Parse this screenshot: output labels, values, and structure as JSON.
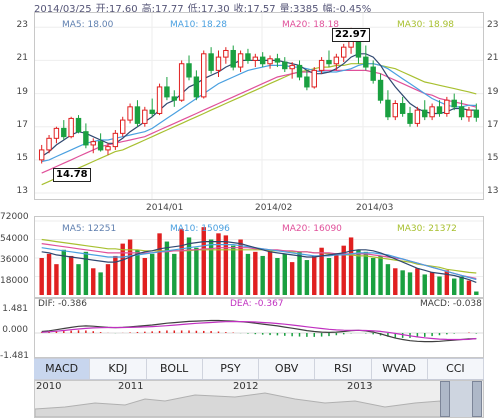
{
  "header": {
    "date": "2014/03/25",
    "open": "开:17.60",
    "high": "高:17.77",
    "low": "低:17.30",
    "close": "收:17.57",
    "volume": "量:3385",
    "change": "幅:-0.45%"
  },
  "price_panel": {
    "legend": [
      {
        "label": "MA5: 18.00",
        "color": "#6080b0"
      },
      {
        "label": "MA10: 18.28",
        "color": "#4aa0e0"
      },
      {
        "label": "MA20: 18.18",
        "color": "#e0509a"
      },
      {
        "label": "MA30: 18.98",
        "color": "#a8c030"
      }
    ],
    "y_ticks": [
      "23",
      "21",
      "19",
      "17",
      "15",
      "13"
    ],
    "x_ticks": [
      "2014/01",
      "2014/02",
      "2014/03"
    ],
    "max_label": "22.97",
    "min_label": "14.78",
    "up_color": "#e02020",
    "down_color": "#1aa040"
  },
  "volume_panel": {
    "legend": [
      {
        "label": "MA5: 12251",
        "color": "#6080b0"
      },
      {
        "label": "MA10: 15096",
        "color": "#4aa0e0"
      },
      {
        "label": "MA20: 16090",
        "color": "#e0509a"
      },
      {
        "label": "MA30: 21372",
        "color": "#a8c030"
      }
    ],
    "y_ticks": [
      "72000",
      "54000",
      "36000",
      "18000"
    ]
  },
  "macd_panel": {
    "legend": [
      {
        "label": "DIF: -0.386",
        "color": "#404040"
      },
      {
        "label": "DEA: -0.367",
        "color": "#c030c0"
      },
      {
        "label": "MACD: -0.038",
        "color": "#404040"
      }
    ],
    "y_ticks": [
      "1.481",
      "0.000",
      "-1.481"
    ]
  },
  "indicator_tabs": [
    "MACD",
    "KDJ",
    "BOLL",
    "PSY",
    "OBV",
    "RSI",
    "WVAD",
    "CCI"
  ],
  "active_tab": "MACD",
  "navigator": {
    "years": [
      "2010",
      "2011",
      "2012",
      "2013"
    ]
  },
  "chart_data": {
    "type": "candlestick",
    "title": "",
    "ylim": [
      13,
      23.5
    ],
    "up_color": "#e02020",
    "down_color": "#1aa040",
    "candles": [
      [
        15.0,
        15.9,
        14.78,
        15.6
      ],
      [
        15.6,
        16.5,
        15.4,
        16.3
      ],
      [
        16.3,
        17.0,
        16.0,
        16.9
      ],
      [
        16.9,
        17.4,
        16.2,
        16.4
      ],
      [
        16.4,
        17.6,
        16.3,
        17.5
      ],
      [
        17.5,
        17.7,
        16.6,
        16.7
      ],
      [
        16.7,
        17.2,
        15.7,
        15.9
      ],
      [
        15.9,
        16.3,
        15.4,
        16.1
      ],
      [
        16.1,
        16.6,
        15.5,
        15.6
      ],
      [
        15.6,
        16.0,
        15.3,
        15.8
      ],
      [
        15.8,
        16.8,
        15.6,
        16.6
      ],
      [
        16.6,
        17.6,
        16.4,
        17.4
      ],
      [
        17.4,
        18.4,
        17.2,
        18.2
      ],
      [
        18.2,
        18.6,
        17.0,
        17.2
      ],
      [
        17.2,
        18.2,
        17.0,
        18.0
      ],
      [
        18.0,
        18.7,
        17.6,
        17.8
      ],
      [
        17.8,
        19.6,
        17.7,
        19.4
      ],
      [
        19.4,
        20.0,
        18.6,
        18.8
      ],
      [
        18.8,
        19.2,
        18.2,
        18.6
      ],
      [
        18.6,
        21.0,
        18.5,
        20.8
      ],
      [
        20.8,
        21.3,
        19.8,
        20.0
      ],
      [
        20.0,
        20.4,
        18.6,
        18.8
      ],
      [
        18.8,
        21.6,
        18.7,
        21.4
      ],
      [
        21.4,
        21.8,
        20.2,
        20.4
      ],
      [
        20.4,
        21.6,
        20.0,
        21.2
      ],
      [
        21.2,
        21.8,
        20.8,
        21.6
      ],
      [
        21.6,
        21.9,
        20.4,
        20.6
      ],
      [
        20.6,
        21.6,
        20.3,
        21.4
      ],
      [
        21.4,
        21.7,
        20.8,
        21.0
      ],
      [
        21.0,
        21.4,
        20.6,
        21.2
      ],
      [
        21.2,
        21.5,
        20.6,
        20.8
      ],
      [
        20.8,
        21.3,
        20.5,
        21.1
      ],
      [
        21.1,
        21.4,
        20.6,
        20.9
      ],
      [
        20.9,
        21.2,
        20.3,
        20.5
      ],
      [
        20.5,
        20.9,
        19.9,
        20.7
      ],
      [
        20.7,
        21.0,
        19.8,
        20.0
      ],
      [
        20.0,
        20.4,
        19.2,
        19.4
      ],
      [
        19.4,
        20.6,
        19.3,
        20.4
      ],
      [
        20.4,
        21.2,
        20.2,
        21.0
      ],
      [
        21.0,
        21.6,
        20.6,
        20.8
      ],
      [
        20.8,
        21.4,
        20.4,
        21.2
      ],
      [
        21.2,
        22.0,
        20.9,
        21.8
      ],
      [
        21.8,
        22.97,
        21.4,
        22.4
      ],
      [
        22.4,
        22.6,
        20.8,
        21.2
      ],
      [
        21.2,
        21.9,
        20.4,
        20.6
      ],
      [
        20.6,
        21.0,
        19.6,
        19.8
      ],
      [
        19.8,
        20.2,
        18.4,
        18.6
      ],
      [
        18.6,
        19.2,
        17.4,
        17.6
      ],
      [
        17.6,
        18.6,
        17.4,
        18.4
      ],
      [
        18.4,
        18.8,
        17.6,
        17.8
      ],
      [
        17.8,
        18.2,
        17.0,
        17.2
      ],
      [
        17.2,
        18.2,
        17.0,
        18.0
      ],
      [
        18.0,
        18.6,
        17.4,
        17.6
      ],
      [
        17.6,
        18.4,
        17.4,
        18.2
      ],
      [
        18.2,
        18.6,
        17.6,
        17.8
      ],
      [
        17.8,
        18.8,
        17.6,
        18.6
      ],
      [
        18.6,
        19.0,
        18.0,
        18.2
      ],
      [
        18.2,
        18.6,
        17.4,
        17.6
      ],
      [
        17.6,
        18.2,
        17.3,
        18.0
      ],
      [
        18.0,
        18.4,
        17.3,
        17.57
      ]
    ],
    "ma5": [
      15.2,
      15.5,
      15.9,
      16.2,
      16.5,
      16.7,
      16.6,
      16.4,
      16.2,
      16.0,
      16.0,
      16.3,
      16.7,
      17.0,
      17.3,
      17.6,
      18.0,
      18.4,
      18.6,
      19.0,
      19.4,
      19.6,
      19.9,
      20.1,
      20.3,
      20.6,
      20.8,
      21.0,
      21.0,
      21.0,
      21.0,
      21.0,
      21.0,
      20.9,
      20.8,
      20.7,
      20.4,
      20.2,
      20.2,
      20.3,
      20.5,
      20.8,
      21.2,
      21.4,
      21.4,
      21.2,
      20.7,
      20.0,
      19.4,
      18.9,
      18.4,
      18.1,
      17.9,
      17.8,
      17.8,
      17.9,
      18.1,
      18.1,
      18.0,
      18.0
    ],
    "ma10": [
      14.9,
      15.0,
      15.2,
      15.4,
      15.6,
      15.8,
      16.0,
      16.1,
      16.2,
      16.2,
      16.3,
      16.4,
      16.5,
      16.6,
      16.7,
      16.9,
      17.2,
      17.5,
      17.8,
      18.1,
      18.4,
      18.7,
      19.0,
      19.3,
      19.6,
      19.8,
      20.0,
      20.2,
      20.4,
      20.5,
      20.6,
      20.7,
      20.7,
      20.7,
      20.6,
      20.6,
      20.5,
      20.4,
      20.3,
      20.3,
      20.3,
      20.4,
      20.5,
      20.7,
      20.8,
      20.8,
      20.7,
      20.5,
      20.2,
      19.9,
      19.6,
      19.3,
      19.0,
      18.7,
      18.5,
      18.3,
      18.2,
      18.2,
      18.3,
      18.28
    ],
    "ma20": [
      14.2,
      14.4,
      14.6,
      14.8,
      15.0,
      15.2,
      15.4,
      15.6,
      15.8,
      15.9,
      16.0,
      16.1,
      16.2,
      16.3,
      16.4,
      16.6,
      16.8,
      17.0,
      17.2,
      17.4,
      17.6,
      17.8,
      18.0,
      18.2,
      18.4,
      18.6,
      18.8,
      19.0,
      19.2,
      19.4,
      19.6,
      19.8,
      20.0,
      20.1,
      20.2,
      20.3,
      20.3,
      20.3,
      20.4,
      20.4,
      20.4,
      20.4,
      20.4,
      20.4,
      20.4,
      20.3,
      20.2,
      20.0,
      19.8,
      19.6,
      19.4,
      19.2,
      19.0,
      18.9,
      18.7,
      18.6,
      18.5,
      18.4,
      18.3,
      18.18
    ],
    "ma30": [
      13.5,
      13.7,
      13.9,
      14.1,
      14.3,
      14.5,
      14.7,
      14.9,
      15.1,
      15.3,
      15.5,
      15.6,
      15.8,
      16.0,
      16.2,
      16.4,
      16.6,
      16.8,
      17.0,
      17.2,
      17.4,
      17.6,
      17.8,
      18.0,
      18.2,
      18.4,
      18.6,
      18.8,
      19.0,
      19.2,
      19.4,
      19.6,
      19.8,
      20.0,
      20.2,
      20.3,
      20.4,
      20.5,
      20.6,
      20.6,
      20.7,
      20.7,
      20.8,
      20.8,
      20.8,
      20.8,
      20.7,
      20.6,
      20.5,
      20.3,
      20.1,
      19.9,
      19.7,
      19.6,
      19.5,
      19.4,
      19.3,
      19.2,
      19.1,
      18.98
    ],
    "volume": {
      "ylim": [
        0,
        72000
      ],
      "values": [
        36000,
        40000,
        30000,
        44000,
        38000,
        30000,
        42000,
        26000,
        22000,
        30000,
        38000,
        50000,
        54000,
        44000,
        36000,
        40000,
        60000,
        52000,
        40000,
        64000,
        56000,
        46000,
        66000,
        54000,
        60000,
        58000,
        48000,
        54000,
        40000,
        42000,
        38000,
        44000,
        36000,
        40000,
        32000,
        42000,
        34000,
        38000,
        46000,
        36000,
        40000,
        48000,
        56000,
        44000,
        42000,
        36000,
        38000,
        30000,
        26000,
        24000,
        22000,
        26000,
        20000,
        22000,
        18000,
        24000,
        16000,
        18000,
        14000,
        3385
      ],
      "ma5": [
        42000,
        41000,
        39000,
        38000,
        37000,
        36000,
        35000,
        34000,
        33000,
        32000,
        32000,
        34000,
        37000,
        40000,
        42000,
        43000,
        45000,
        46000,
        47000,
        48000,
        50000,
        51000,
        52000,
        52000,
        52000,
        52000,
        51000,
        50000,
        48000,
        46000,
        44000,
        42000,
        41000,
        40000,
        39000,
        38000,
        37000,
        37000,
        38000,
        39000,
        40000,
        41000,
        43000,
        44000,
        44000,
        43000,
        41000,
        38000,
        35000,
        32000,
        29000,
        26000,
        24000,
        22000,
        21000,
        20000,
        19000,
        17000,
        15000,
        12251
      ],
      "ma10": [
        46000,
        45000,
        44000,
        43000,
        42000,
        41000,
        40000,
        39000,
        38000,
        37000,
        37000,
        37000,
        38000,
        39000,
        40000,
        41000,
        42000,
        43000,
        44000,
        45000,
        46000,
        47000,
        48000,
        49000,
        49000,
        49000,
        49000,
        48000,
        47000,
        46000,
        45000,
        44000,
        43000,
        42000,
        41000,
        40000,
        39000,
        38000,
        38000,
        38000,
        39000,
        39000,
        40000,
        41000,
        41000,
        41000,
        40000,
        39000,
        37000,
        35000,
        33000,
        31000,
        29000,
        27000,
        25000,
        23000,
        21000,
        19000,
        17000,
        15096
      ],
      "ma20": [
        50000,
        49000,
        48000,
        47000,
        46000,
        45000,
        44000,
        43000,
        42000,
        41000,
        41000,
        41000,
        41000,
        41000,
        41000,
        41000,
        42000,
        42000,
        43000,
        43000,
        44000,
        44000,
        45000,
        45000,
        46000,
        46000,
        46000,
        46000,
        46000,
        45000,
        45000,
        44000,
        44000,
        43000,
        43000,
        42000,
        42000,
        41000,
        41000,
        41000,
        40000,
        40000,
        40000,
        40000,
        40000,
        39000,
        38000,
        37000,
        36000,
        35000,
        33000,
        31000,
        29000,
        27000,
        25000,
        23000,
        21000,
        19000,
        17500,
        16090
      ],
      "ma30": [
        54000,
        53000,
        52000,
        51000,
        50000,
        49000,
        48000,
        47000,
        46000,
        45000,
        45000,
        44000,
        44000,
        44000,
        43000,
        43000,
        43000,
        43000,
        43000,
        43000,
        43000,
        44000,
        44000,
        44000,
        44000,
        44000,
        44000,
        44000,
        44000,
        44000,
        44000,
        43000,
        43000,
        43000,
        42000,
        42000,
        42000,
        41000,
        41000,
        40000,
        40000,
        39000,
        39000,
        38000,
        38000,
        37000,
        36000,
        35000,
        34000,
        33000,
        32000,
        30000,
        29000,
        28000,
        27000,
        25000,
        24000,
        23000,
        22000,
        21372
      ]
    },
    "macd": {
      "ylim": [
        -1.481,
        1.481
      ],
      "dif": [
        0.1,
        0.15,
        0.22,
        0.3,
        0.38,
        0.45,
        0.48,
        0.46,
        0.42,
        0.38,
        0.36,
        0.38,
        0.42,
        0.46,
        0.5,
        0.54,
        0.6,
        0.66,
        0.7,
        0.74,
        0.78,
        0.8,
        0.82,
        0.84,
        0.84,
        0.82,
        0.8,
        0.76,
        0.72,
        0.66,
        0.6,
        0.54,
        0.48,
        0.4,
        0.32,
        0.24,
        0.16,
        0.1,
        0.06,
        0.04,
        0.06,
        0.1,
        0.16,
        0.18,
        0.14,
        0.06,
        -0.06,
        -0.2,
        -0.34,
        -0.44,
        -0.52,
        -0.56,
        -0.58,
        -0.58,
        -0.56,
        -0.52,
        -0.48,
        -0.44,
        -0.4,
        -0.386
      ],
      "dea": [
        0.05,
        0.08,
        0.12,
        0.17,
        0.22,
        0.27,
        0.31,
        0.34,
        0.36,
        0.37,
        0.37,
        0.37,
        0.38,
        0.39,
        0.41,
        0.43,
        0.46,
        0.49,
        0.53,
        0.57,
        0.61,
        0.65,
        0.68,
        0.71,
        0.74,
        0.76,
        0.77,
        0.77,
        0.76,
        0.74,
        0.71,
        0.68,
        0.64,
        0.59,
        0.54,
        0.48,
        0.42,
        0.36,
        0.3,
        0.25,
        0.21,
        0.19,
        0.18,
        0.18,
        0.17,
        0.15,
        0.11,
        0.05,
        -0.03,
        -0.11,
        -0.19,
        -0.26,
        -0.32,
        -0.37,
        -0.41,
        -0.43,
        -0.44,
        -0.44,
        -0.43,
        -0.367
      ],
      "hist": [
        0.05,
        0.07,
        0.1,
        0.13,
        0.16,
        0.18,
        0.17,
        0.12,
        0.06,
        0.01,
        -0.01,
        0.01,
        0.04,
        0.07,
        0.09,
        0.11,
        0.14,
        0.17,
        0.17,
        0.17,
        0.17,
        0.15,
        0.14,
        0.13,
        0.1,
        0.06,
        0.03,
        -0.01,
        -0.04,
        -0.08,
        -0.11,
        -0.14,
        -0.16,
        -0.19,
        -0.22,
        -0.24,
        -0.26,
        -0.26,
        -0.24,
        -0.21,
        -0.15,
        -0.09,
        -0.02,
        0.0,
        -0.03,
        -0.09,
        -0.17,
        -0.25,
        -0.31,
        -0.33,
        -0.33,
        -0.3,
        -0.26,
        -0.21,
        -0.15,
        -0.09,
        -0.04,
        0.0,
        0.03,
        -0.038
      ]
    }
  }
}
